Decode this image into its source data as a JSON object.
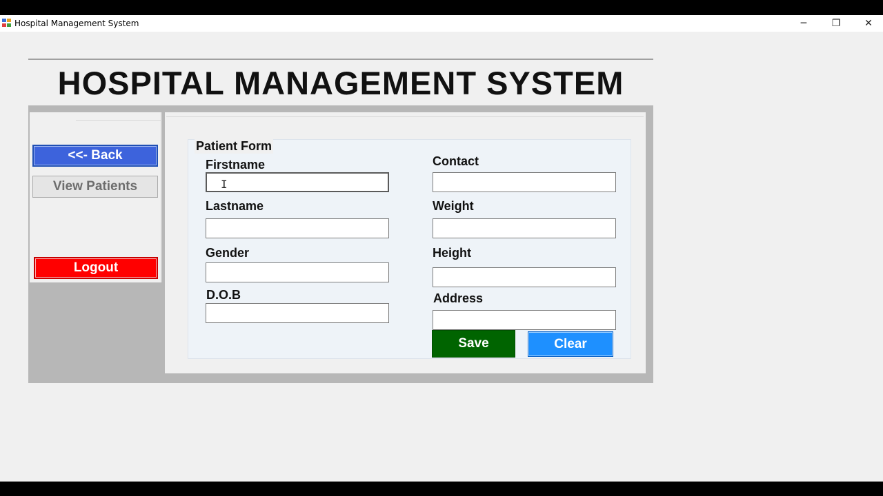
{
  "window": {
    "title": "Hospital Management System",
    "minimize_glyph": "─",
    "restore_glyph": "❐",
    "close_glyph": "✕"
  },
  "header": {
    "title": "HOSPITAL MANAGEMENT SYSTEM"
  },
  "sidebar": {
    "back_label": "<<- Back",
    "view_patients_label": "View Patients",
    "logout_label": "Logout"
  },
  "form": {
    "group_title": "Patient Form",
    "fields": {
      "firstname": {
        "label": "Firstname",
        "value": ""
      },
      "lastname": {
        "label": "Lastname",
        "value": ""
      },
      "gender": {
        "label": "Gender",
        "value": ""
      },
      "dob": {
        "label": "D.O.B",
        "value": ""
      },
      "contact": {
        "label": "Contact",
        "value": ""
      },
      "weight": {
        "label": "Weight",
        "value": ""
      },
      "height": {
        "label": "Height",
        "value": ""
      },
      "address": {
        "label": "Address",
        "value": ""
      }
    },
    "save_label": "Save",
    "clear_label": "Clear"
  },
  "colors": {
    "back_button": "#3d63dc",
    "logout_button": "#ff0000",
    "save_button": "#006400",
    "clear_button": "#1e90ff",
    "frame": "#b7b7b7"
  },
  "icons": {
    "app": "app-window-icon",
    "text_cursor": "i-beam-cursor-icon"
  }
}
